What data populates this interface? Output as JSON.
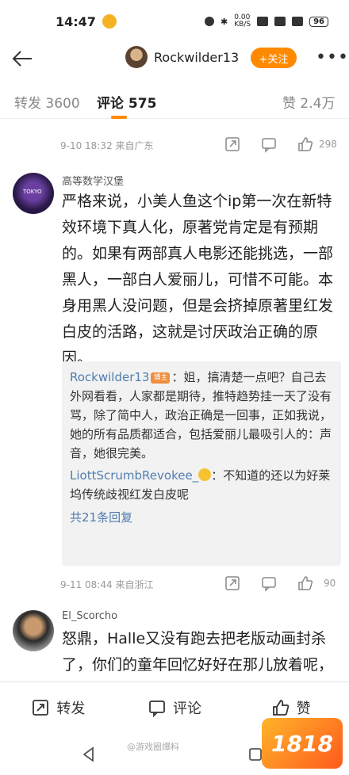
{
  "status": {
    "time": "14:47",
    "net_speed": "0.00\nKB/S",
    "battery": "96"
  },
  "header": {
    "username": "Rockwilder13",
    "follow_label": "+关注"
  },
  "tabs": {
    "repost": "转发 3600",
    "comment": "评论 575",
    "like": "赞 2.4万"
  },
  "prev_meta": {
    "time": "9-10 18:32 来自广东",
    "likes": "298"
  },
  "comment1": {
    "name": "高等数学汉堡",
    "text": "严格来说，小美人鱼这个ip第一次在新特效环境下真人化，原著党肯定是有预期的。如果有两部真人电影还能挑选，一部黑人，一部白人爱丽儿，可惜不可能。本身用黑人没问题，但是会挤掉原著里红发白皮的活路，这就是讨厌政治正确的原因。",
    "replies": [
      {
        "author": "Rockwilder13",
        "tag": "博主",
        "text": "：姐，搞清楚一点吧？自己去外网看看，人家都是期待，推特趋势挂一天了没有骂，除了简中人，政治正确是一回事，正如我说，她的所有品质都适合，包括爱丽儿最吸引人的：声音，她很完美。"
      },
      {
        "author": "LiottScrumbRevokee_",
        "text": "：不知道的还以为好莱坞传统歧视红发白皮呢"
      }
    ],
    "more": "共21条回复",
    "time": "9-11 08:44 来自浙江",
    "likes": "90"
  },
  "comment2": {
    "name": "El_Scorcho",
    "text": "怒鼎，Halle又没有跑去把老版动画封杀了，你们的童年回忆好好在那儿放着呢，不喜欢的不看就行了，反正"
  },
  "bottom": {
    "repost": "转发",
    "comment": "评论",
    "like": "赞"
  },
  "watermark": "@游戏圈爆料",
  "logo": "1818"
}
